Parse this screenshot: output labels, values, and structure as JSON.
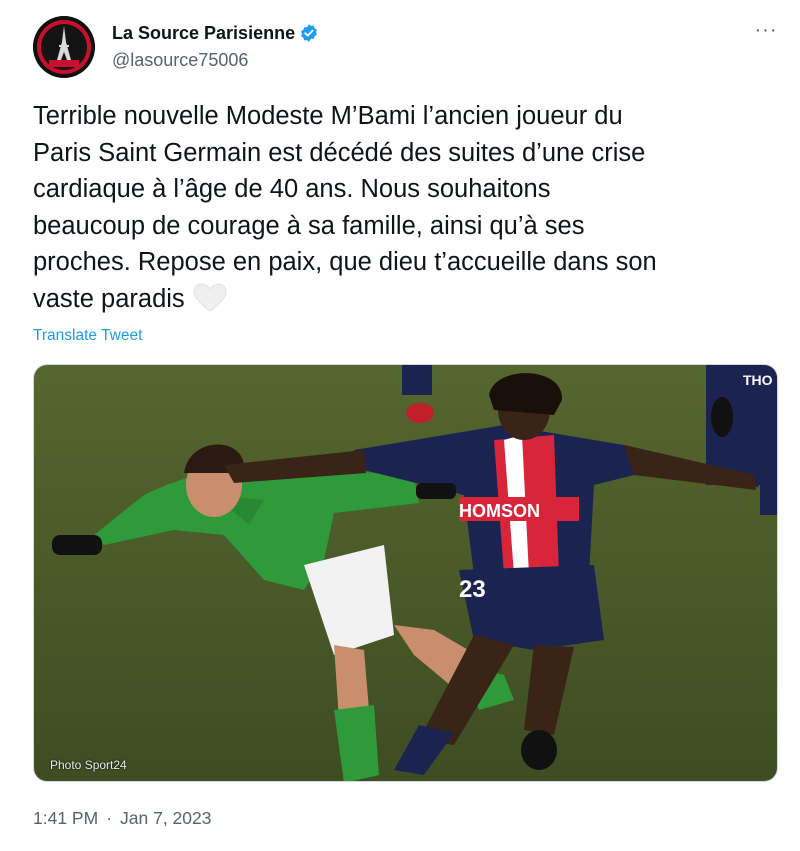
{
  "account": {
    "display_name": "La Source Parisienne",
    "handle": "@lasource75006",
    "verified": true,
    "avatar_icon": "eiffel-tower-logo"
  },
  "menu": {
    "more_icon": "more-dots-icon"
  },
  "tweet": {
    "text": "Terrible nouvelle Modeste M’Bami l’ancien joueur du\nParis Saint Germain est décédé des suites d’une crise\ncardiaque à l’âge de 40 ans. Nous souhaitons\nbeaucoup de courage à sa famille, ainsi qu’à ses\nproches. Repose en paix, que dieu t’accueille dans son\nvaste paradis",
    "emoji": "white-heart-icon",
    "translate_label": "Translate Tweet"
  },
  "media": {
    "photo_credit": "Photo Sport24",
    "jersey_sponsor": "HOMSON",
    "jersey_number": "23",
    "jersey_partial": "THO"
  },
  "meta": {
    "time": "1:41 PM",
    "separator": "·",
    "date": "Jan 7, 2023"
  },
  "colors": {
    "link": "#1d9bf0",
    "secondary_text": "#536471",
    "verified_badge": "#1d9bf0",
    "psg_navy": "#1b2350",
    "psg_red": "#d8253a",
    "ase_green": "#2f9a3a",
    "pitch": "#4a5a2c"
  }
}
